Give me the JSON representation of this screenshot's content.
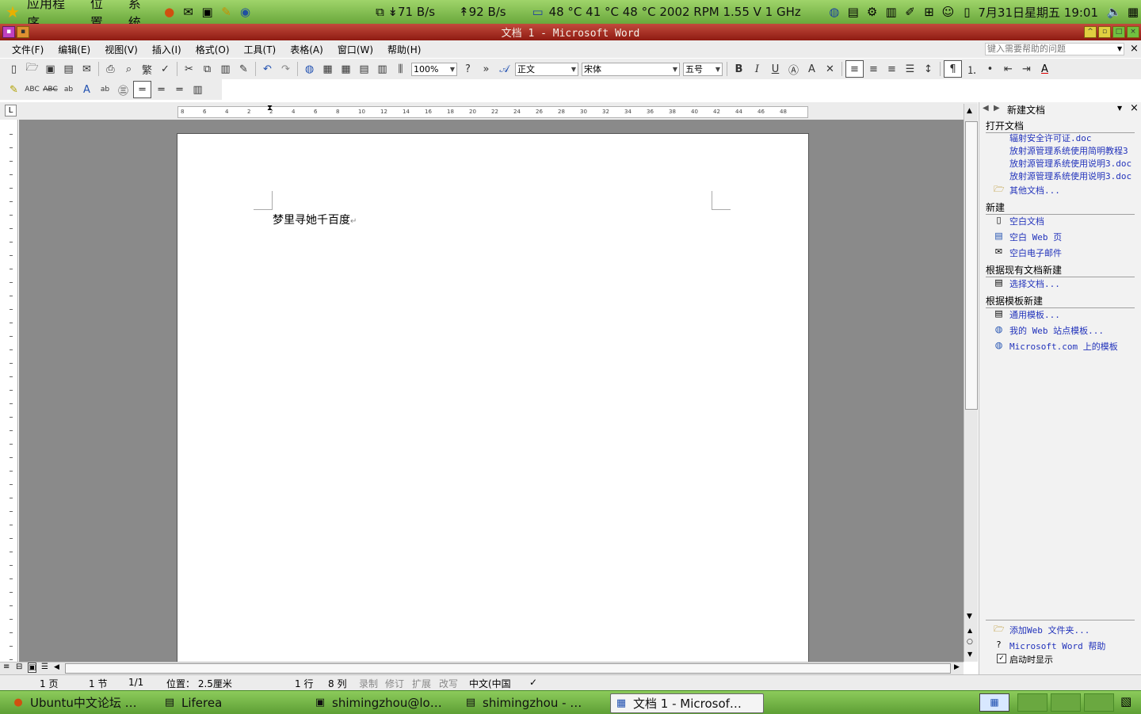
{
  "top_panel": {
    "menus": [
      "应用程序",
      "位置",
      "系统"
    ],
    "net_down": "71 B/s",
    "net_up": "92 B/s",
    "sensors": "48 °C 41 °C 48 °C 2002 RPM 1.55 V 1 GHz",
    "clock": "7月31日星期五 19:01"
  },
  "window": {
    "title": "文档 1 - Microsoft Word"
  },
  "menubar": {
    "items": [
      "文件(F)",
      "编辑(E)",
      "视图(V)",
      "插入(I)",
      "格式(O)",
      "工具(T)",
      "表格(A)",
      "窗口(W)",
      "帮助(H)"
    ],
    "help_placeholder": "键入需要帮助的问题"
  },
  "format_toolbar": {
    "zoom": "100%",
    "style": "正文",
    "font": "宋体",
    "size": "五号"
  },
  "ruler_ticks": [
    "8",
    "6",
    "4",
    "2",
    "2",
    "4",
    "6",
    "8",
    "10",
    "12",
    "14",
    "16",
    "18",
    "20",
    "22",
    "24",
    "26",
    "28",
    "30",
    "32",
    "34",
    "36",
    "38",
    "40",
    "42",
    "44",
    "46",
    "48"
  ],
  "document": {
    "text": "梦里寻她千百度",
    "para_mark": "↵"
  },
  "statusbar": {
    "page": "1 页",
    "section": "1 节",
    "page_of": "1/1",
    "position": "位置： 2.5厘米",
    "line": "1 行",
    "column": "8 列",
    "rec": "录制",
    "trk": "修订",
    "ext": "扩展",
    "ovr": "改写",
    "language": "中文(中国"
  },
  "taskpane": {
    "title": "新建文档",
    "open_heading": "打开文档",
    "recent_files": [
      "辐射安全许可证.doc",
      "放射源管理系统使用简明教程3",
      "放射源管理系统使用说明3.doc",
      "放射源管理系统使用说明3.doc"
    ],
    "other_docs": "其他文档...",
    "new_heading": "新建",
    "blank_doc": "空白文档",
    "blank_web": "空白 Web 页",
    "blank_email": "空白电子邮件",
    "from_existing_heading": "根据现有文档新建",
    "choose_doc": "选择文档...",
    "from_template_heading": "根据模板新建",
    "general_templates": "通用模板...",
    "web_templates": "我的 Web 站点模板...",
    "ms_templates": "Microsoft.com 上的模板",
    "add_web_folder": "添加Web 文件夹...",
    "word_help": "Microsoft Word 帮助",
    "show_on_startup": "启动时显示"
  },
  "taskbar": {
    "tasks": [
      "Ubuntu中文论坛 …",
      "Liferea",
      "shimingzhou@lo…",
      "shimingzhou - …",
      "文档 1 - Microsof…"
    ]
  }
}
